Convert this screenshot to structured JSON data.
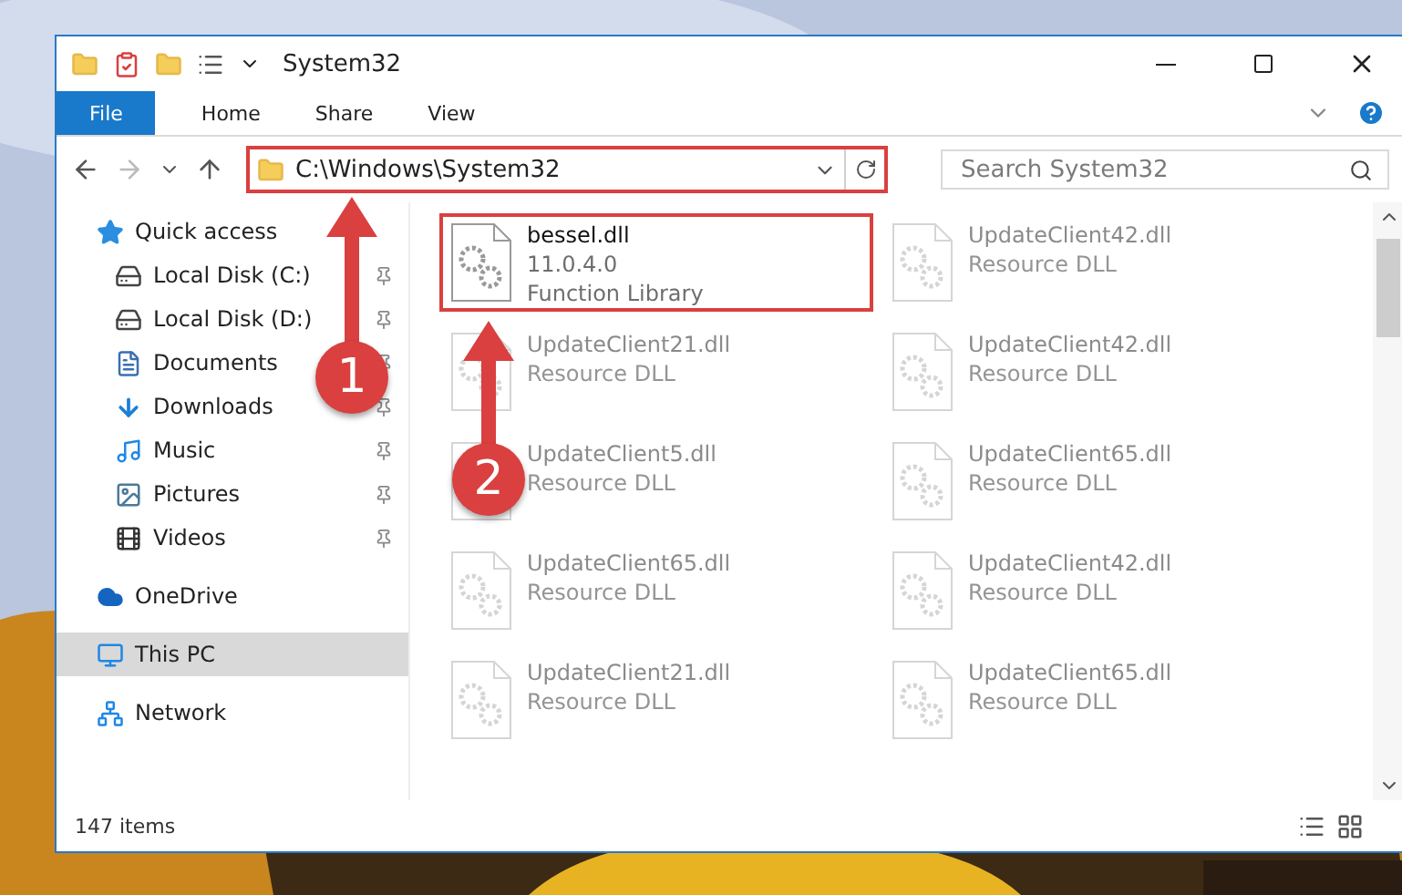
{
  "window": {
    "title": "System32"
  },
  "ribbon": {
    "tabs": [
      {
        "label": "File",
        "kind": "file",
        "selected": false
      },
      {
        "label": "Home",
        "kind": "tab",
        "selected": false
      },
      {
        "label": "Share",
        "kind": "tab",
        "selected": false
      },
      {
        "label": "View",
        "kind": "tab",
        "selected": false
      }
    ]
  },
  "address": {
    "path": "C:\\Windows\\System32",
    "search_placeholder": "Search System32"
  },
  "sidebar": {
    "items": [
      {
        "label": "Quick access",
        "kind": "star",
        "selected": false,
        "children": [
          {
            "label": "Local Disk (C:)",
            "kind": "drive",
            "pinned": true,
            "selected": false
          },
          {
            "label": "Local Disk (D:)",
            "kind": "drive",
            "pinned": true,
            "selected": false
          },
          {
            "label": "Documents",
            "kind": "documents",
            "pinned": true,
            "selected": false
          },
          {
            "label": "Downloads",
            "kind": "downloads",
            "pinned": true,
            "selected": false
          },
          {
            "label": "Music",
            "kind": "music",
            "pinned": true,
            "selected": false
          },
          {
            "label": "Pictures",
            "kind": "pictures",
            "pinned": true,
            "selected": false
          },
          {
            "label": "Videos",
            "kind": "videos",
            "pinned": true,
            "selected": false
          }
        ]
      },
      {
        "label": "OneDrive",
        "kind": "cloud",
        "selected": false
      },
      {
        "label": "This PC",
        "kind": "pc",
        "selected": true
      },
      {
        "label": "Network",
        "kind": "network",
        "selected": false
      }
    ]
  },
  "files": [
    {
      "name": "bessel.dll",
      "lines": [
        "11.0.4.0",
        "Function Library"
      ],
      "blurred": false,
      "highlighted": true
    },
    {
      "name": "UpdateClient42.dll",
      "lines": [
        "Resource DLL"
      ],
      "blurred": true,
      "highlighted": false
    },
    {
      "name": "UpdateClient21.dll",
      "lines": [
        "Resource DLL"
      ],
      "blurred": true,
      "highlighted": false
    },
    {
      "name": "UpdateClient42.dll",
      "lines": [
        "Resource DLL"
      ],
      "blurred": true,
      "highlighted": false
    },
    {
      "name": "UpdateClient5.dll",
      "lines": [
        "Resource DLL"
      ],
      "blurred": true,
      "highlighted": false
    },
    {
      "name": "UpdateClient65.dll",
      "lines": [
        "Resource DLL"
      ],
      "blurred": true,
      "highlighted": false
    },
    {
      "name": "UpdateClient65.dll",
      "lines": [
        "Resource DLL"
      ],
      "blurred": true,
      "highlighted": false
    },
    {
      "name": "UpdateClient42.dll",
      "lines": [
        "Resource DLL"
      ],
      "blurred": true,
      "highlighted": false
    },
    {
      "name": "UpdateClient21.dll",
      "lines": [
        "Resource DLL"
      ],
      "blurred": true,
      "highlighted": false
    },
    {
      "name": "UpdateClient65.dll",
      "lines": [
        "Resource DLL"
      ],
      "blurred": true,
      "highlighted": false
    }
  ],
  "annotations": [
    {
      "number": "1",
      "kind": "address"
    },
    {
      "number": "2",
      "kind": "file"
    }
  ],
  "status_bar": {
    "count": "147 items"
  }
}
